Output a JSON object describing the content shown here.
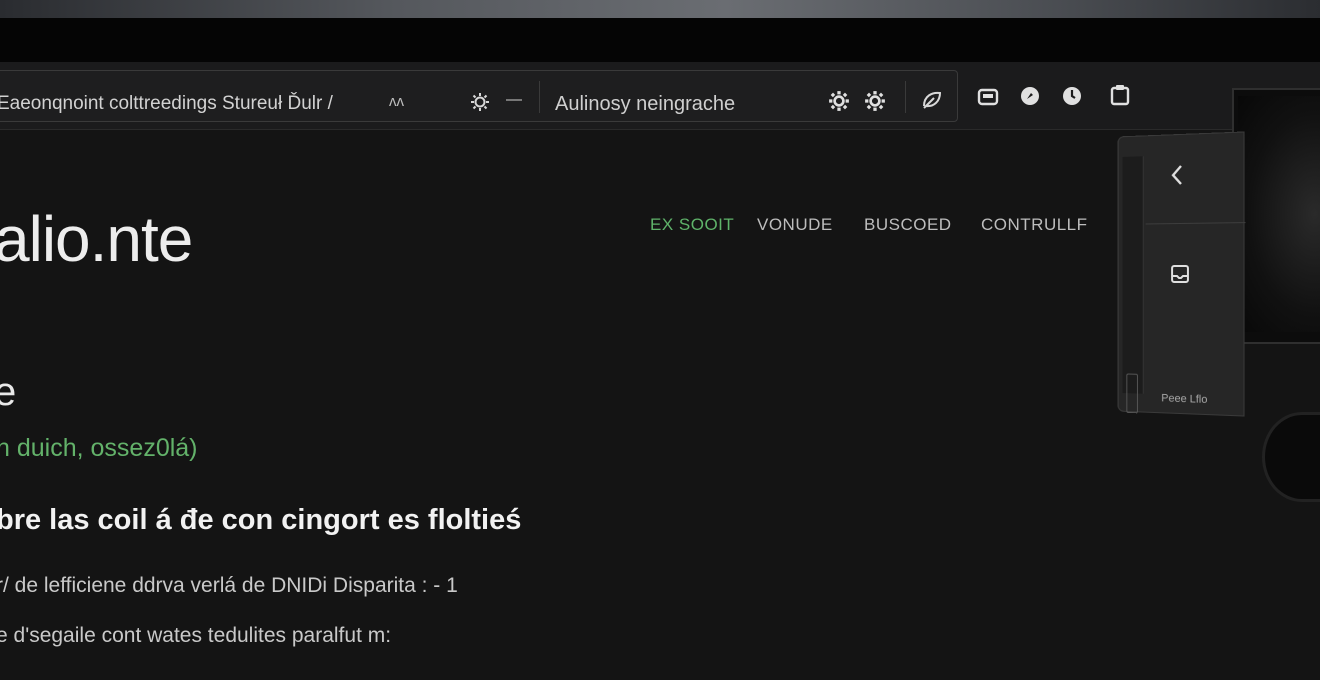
{
  "browser": {
    "url": "Eaeonqnoint colttreedings Stureuł Ďulr /",
    "url_suffix": "ᴧᴧ",
    "search_text": "Aulinosy neingrache"
  },
  "site": {
    "logo": "alio.nte",
    "nav": [
      {
        "label": "EX SOOIT",
        "active": true
      },
      {
        "label": "VONUDE",
        "active": false
      },
      {
        "label": "BUSCOED",
        "active": false
      },
      {
        "label": "CONTRULLF",
        "active": false
      }
    ]
  },
  "content": {
    "heading": "e",
    "subheading": "n duich, ossez0lá)",
    "bold_line": "bre las coil á đe con cingort es floltieś",
    "line_1": "r/ de lefficiene ddrva verlá de DNIDi Disparita   :  - 1",
    "line_2": "e d'segaile cont wates tedulites paralfut m:"
  },
  "side_panel": {
    "label": "Peee Lflo"
  },
  "colors": {
    "accent_green": "#5fb36a",
    "background": "#141414"
  }
}
